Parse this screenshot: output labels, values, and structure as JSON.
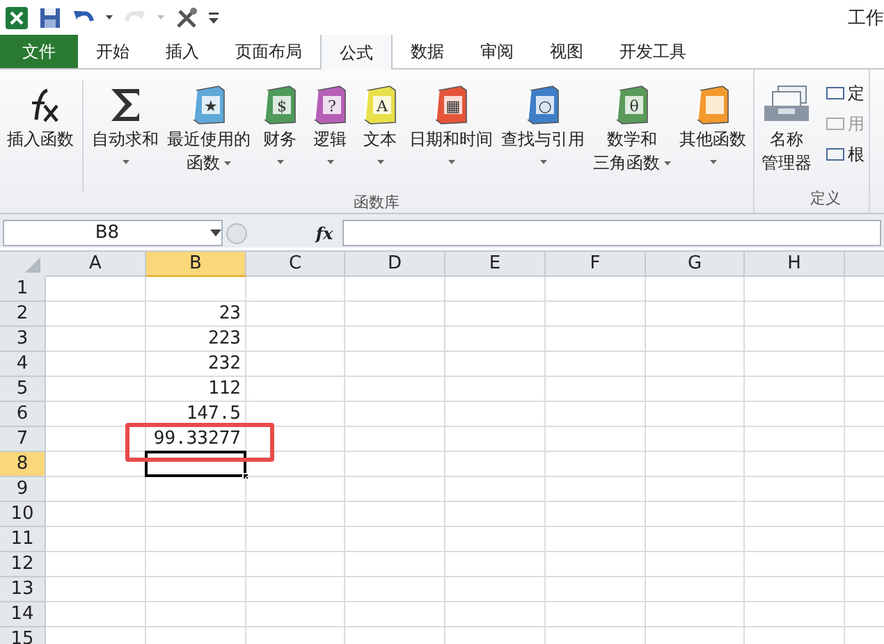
{
  "window": {
    "title": "工作"
  },
  "quick_access": [
    {
      "kind": "save"
    },
    {
      "kind": "undo"
    },
    {
      "kind": "redo",
      "disabled": true
    },
    {
      "kind": "tools"
    }
  ],
  "tabs": [
    {
      "label": "文件",
      "kind": "file",
      "selected": false
    },
    {
      "label": "开始",
      "selected": false
    },
    {
      "label": "插入",
      "selected": false
    },
    {
      "label": "页面布局",
      "selected": false
    },
    {
      "label": "公式",
      "selected": true
    },
    {
      "label": "数据",
      "selected": false
    },
    {
      "label": "审阅",
      "selected": false
    },
    {
      "label": "视图",
      "selected": false
    },
    {
      "label": "开发工具",
      "selected": false
    }
  ],
  "ribbon": {
    "groups": [
      {
        "label": "函数库",
        "buttons": [
          {
            "kind": "fx",
            "lines": [
              "插入函数"
            ],
            "dropdown": false
          },
          {
            "kind": "sigma",
            "lines": [
              "自动求和"
            ],
            "dropdown": true
          },
          {
            "kind": "book",
            "color": "#5fa8d8",
            "glyph": "★",
            "lines": [
              "最近使用的",
              "函数"
            ],
            "dropdown": true
          },
          {
            "kind": "book",
            "color": "#4f9a5a",
            "glyph": "$",
            "lines": [
              "财务"
            ],
            "dropdown": true
          },
          {
            "kind": "book",
            "color": "#b55fb5",
            "glyph": "?",
            "lines": [
              "逻辑"
            ],
            "dropdown": true
          },
          {
            "kind": "book",
            "color": "#e8e04a",
            "glyph": "A",
            "lines": [
              "文本"
            ],
            "dropdown": true
          },
          {
            "kind": "book",
            "color": "#e4553a",
            "glyph": "▦",
            "lines": [
              "日期和时间"
            ],
            "dropdown": true
          },
          {
            "kind": "book",
            "color": "#3f7fc8",
            "glyph": "○",
            "lines": [
              "查找与引用"
            ],
            "dropdown": true
          },
          {
            "kind": "book",
            "color": "#5a9a5a",
            "glyph": "θ",
            "lines": [
              "数学和",
              "三角函数"
            ],
            "dropdown": true
          },
          {
            "kind": "book",
            "color": "#f29a2e",
            "lines": [
              "其他函数"
            ],
            "dropdown": true
          }
        ]
      },
      {
        "label": "定义",
        "buttons": [
          {
            "kind": "cards",
            "lines": [
              "名称",
              "管理器"
            ],
            "dropdown": false
          }
        ],
        "small_buttons": [
          {
            "label": "定",
            "disabled": false
          },
          {
            "label": "用",
            "disabled": true
          },
          {
            "label": "根",
            "disabled": false
          }
        ]
      }
    ]
  },
  "formula_bar": {
    "name_box": "B8",
    "fx": "fx"
  },
  "sheet": {
    "columns": [
      {
        "label": "A",
        "selected": false
      },
      {
        "label": "B",
        "selected": true
      },
      {
        "label": "C",
        "selected": false
      },
      {
        "label": "D",
        "selected": false
      },
      {
        "label": "E",
        "selected": false
      },
      {
        "label": "F",
        "selected": false
      },
      {
        "label": "G",
        "selected": false
      },
      {
        "label": "H",
        "selected": false
      }
    ],
    "rows": [
      {
        "label": "1",
        "selected": false
      },
      {
        "label": "2",
        "selected": false,
        "b": "23"
      },
      {
        "label": "3",
        "selected": false,
        "b": "223"
      },
      {
        "label": "4",
        "selected": false,
        "b": "232"
      },
      {
        "label": "5",
        "selected": false,
        "b": "112"
      },
      {
        "label": "6",
        "selected": false,
        "b": "147.5"
      },
      {
        "label": "7",
        "selected": false,
        "b": "99.33277",
        "highlighted": true
      },
      {
        "label": "8",
        "selected": true
      },
      {
        "label": "9",
        "selected": false
      },
      {
        "label": "10",
        "selected": false
      },
      {
        "label": "11",
        "selected": false
      },
      {
        "label": "12",
        "selected": false
      },
      {
        "label": "13",
        "selected": false
      },
      {
        "label": "14",
        "selected": false
      },
      {
        "label": "15",
        "selected": false
      }
    ]
  }
}
